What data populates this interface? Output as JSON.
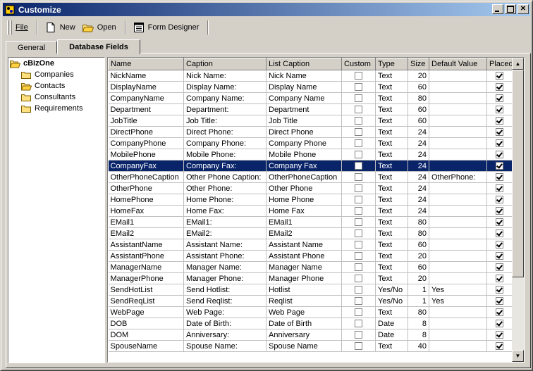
{
  "window": {
    "title": "Customize"
  },
  "toolbar": {
    "file_label": "File",
    "new_label": "New",
    "open_label": "Open",
    "form_designer_label": "Form Designer"
  },
  "tabs": [
    {
      "label": "General"
    },
    {
      "label": "Database Fields"
    }
  ],
  "tree": {
    "root": "cBizOne",
    "children": [
      "Companies",
      "Contacts",
      "Consultants",
      "Requirements"
    ]
  },
  "grid": {
    "columns": [
      "Name",
      "Caption",
      "List Caption",
      "Custom",
      "Type",
      "Size",
      "Default Value",
      "Placed"
    ],
    "selected_row": 8,
    "rows": [
      {
        "name": "NickName",
        "caption": "Nick Name:",
        "list_caption": "Nick Name",
        "custom": false,
        "type": "Text",
        "size": "20",
        "default": "",
        "placed": true
      },
      {
        "name": "DisplayName",
        "caption": "Display Name:",
        "list_caption": "Display Name",
        "custom": false,
        "type": "Text",
        "size": "60",
        "default": "",
        "placed": true
      },
      {
        "name": "CompanyName",
        "caption": "Company Name:",
        "list_caption": "Company Name",
        "custom": false,
        "type": "Text",
        "size": "80",
        "default": "",
        "placed": true
      },
      {
        "name": "Department",
        "caption": "Department:",
        "list_caption": "Department",
        "custom": false,
        "type": "Text",
        "size": "60",
        "default": "",
        "placed": true
      },
      {
        "name": "JobTitle",
        "caption": "Job Title:",
        "list_caption": "Job Title",
        "custom": false,
        "type": "Text",
        "size": "60",
        "default": "",
        "placed": true
      },
      {
        "name": "DirectPhone",
        "caption": "Direct Phone:",
        "list_caption": "Direct Phone",
        "custom": false,
        "type": "Text",
        "size": "24",
        "default": "",
        "placed": true
      },
      {
        "name": "CompanyPhone",
        "caption": "Company Phone:",
        "list_caption": "Company Phone",
        "custom": false,
        "type": "Text",
        "size": "24",
        "default": "",
        "placed": true
      },
      {
        "name": "MobilePhone",
        "caption": "Mobile Phone:",
        "list_caption": "Mobile Phone",
        "custom": false,
        "type": "Text",
        "size": "24",
        "default": "",
        "placed": true
      },
      {
        "name": "CompanyFax",
        "caption": "Company Fax:",
        "list_caption": "Company Fax",
        "custom": false,
        "type": "Text",
        "size": "24",
        "default": "",
        "placed": true
      },
      {
        "name": "OtherPhoneCaption",
        "caption": "Other Phone Caption:",
        "list_caption": "OtherPhoneCaption",
        "custom": false,
        "type": "Text",
        "size": "24",
        "default": "OtherPhone:",
        "placed": true
      },
      {
        "name": "OtherPhone",
        "caption": "Other Phone:",
        "list_caption": "Other Phone",
        "custom": false,
        "type": "Text",
        "size": "24",
        "default": "",
        "placed": true
      },
      {
        "name": "HomePhone",
        "caption": "Home Phone:",
        "list_caption": "Home Phone",
        "custom": false,
        "type": "Text",
        "size": "24",
        "default": "",
        "placed": true
      },
      {
        "name": "HomeFax",
        "caption": "Home Fax:",
        "list_caption": "Home Fax",
        "custom": false,
        "type": "Text",
        "size": "24",
        "default": "",
        "placed": true
      },
      {
        "name": "EMail1",
        "caption": "EMail1:",
        "list_caption": "EMail1",
        "custom": false,
        "type": "Text",
        "size": "80",
        "default": "",
        "placed": true
      },
      {
        "name": "EMail2",
        "caption": "EMail2:",
        "list_caption": "EMail2",
        "custom": false,
        "type": "Text",
        "size": "80",
        "default": "",
        "placed": true
      },
      {
        "name": "AssistantName",
        "caption": "Assistant Name:",
        "list_caption": "Assistant Name",
        "custom": false,
        "type": "Text",
        "size": "60",
        "default": "",
        "placed": true
      },
      {
        "name": "AssistantPhone",
        "caption": "Assistant Phone:",
        "list_caption": "Assistant Phone",
        "custom": false,
        "type": "Text",
        "size": "20",
        "default": "",
        "placed": true
      },
      {
        "name": "ManagerName",
        "caption": "Manager Name:",
        "list_caption": "Manager Name",
        "custom": false,
        "type": "Text",
        "size": "60",
        "default": "",
        "placed": true
      },
      {
        "name": "ManagerPhone",
        "caption": "Manager Phone:",
        "list_caption": "Manager Phone",
        "custom": false,
        "type": "Text",
        "size": "20",
        "default": "",
        "placed": true
      },
      {
        "name": "SendHotList",
        "caption": "Send Hotlist:",
        "list_caption": "Hotlist",
        "custom": false,
        "type": "Yes/No",
        "size": "1",
        "default": "Yes",
        "placed": true
      },
      {
        "name": "SendReqList",
        "caption": "Send Reqlist:",
        "list_caption": "Reqlist",
        "custom": false,
        "type": "Yes/No",
        "size": "1",
        "default": "Yes",
        "placed": true
      },
      {
        "name": "WebPage",
        "caption": "Web Page:",
        "list_caption": "Web Page",
        "custom": false,
        "type": "Text",
        "size": "80",
        "default": "",
        "placed": true
      },
      {
        "name": "DOB",
        "caption": "Date of Birth:",
        "list_caption": "Date of Birth",
        "custom": false,
        "type": "Date",
        "size": "8",
        "default": "",
        "placed": true
      },
      {
        "name": "DOM",
        "caption": "Anniversary:",
        "list_caption": "Anniversary",
        "custom": false,
        "type": "Date",
        "size": "8",
        "default": "",
        "placed": true
      },
      {
        "name": "SpouseName",
        "caption": "Spouse Name:",
        "list_caption": "Spouse Name",
        "custom": false,
        "type": "Text",
        "size": "40",
        "default": "",
        "placed": true
      }
    ]
  },
  "colors": {
    "titlebar_start": "#0a246a",
    "titlebar_end": "#a6caf0",
    "selection": "#0a246a",
    "face": "#d4d0c8"
  }
}
